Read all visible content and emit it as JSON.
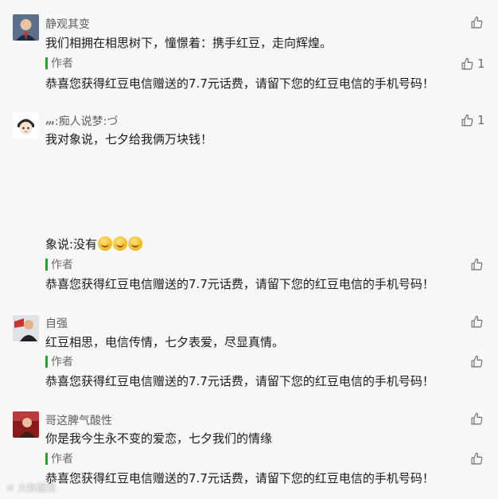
{
  "comments": [
    {
      "nickname": "静观其变",
      "text": "我们相拥在相思树下，憧憬着：携手红豆，走向辉煌。",
      "likes": "1",
      "author_label": "作者",
      "reply": "恭喜您获得红豆电信赠送的7.7元话费，请留下您的红豆电信的手机号码！"
    },
    {
      "nickname": "𝓂:痴人说梦:づ",
      "text": "我对象说，七夕给我俩万块钱！",
      "text2": "象说:没有",
      "likes": "1",
      "author_label": "作者",
      "reply": "恭喜您获得红豆电信赠送的7.7元话费，请留下您的红豆电信的手机号码！"
    },
    {
      "nickname": "自强",
      "text": "红豆相思，电信传情，七夕表爱，尽显真情。",
      "author_label": "作者",
      "reply": "恭喜您获得红豆电信赠送的7.7元话费，请留下您的红豆电信的手机号码！"
    },
    {
      "nickname": "哥这脾气酸性",
      "text": "你是我今生永不变的爱恋，七夕我们的情缘",
      "author_label": "作者",
      "reply": "恭喜您获得红豆电信赠送的7.7元话费，请留下您的红豆电信的手机号码！"
    }
  ],
  "watermark": "大数据观",
  "icons": {
    "like": "thumbs-up-icon",
    "author_marker": "green-bar"
  },
  "colors": {
    "author_bar": "#1aad19",
    "nickname": "#5e5e5e",
    "background": "#f7f7f7"
  }
}
